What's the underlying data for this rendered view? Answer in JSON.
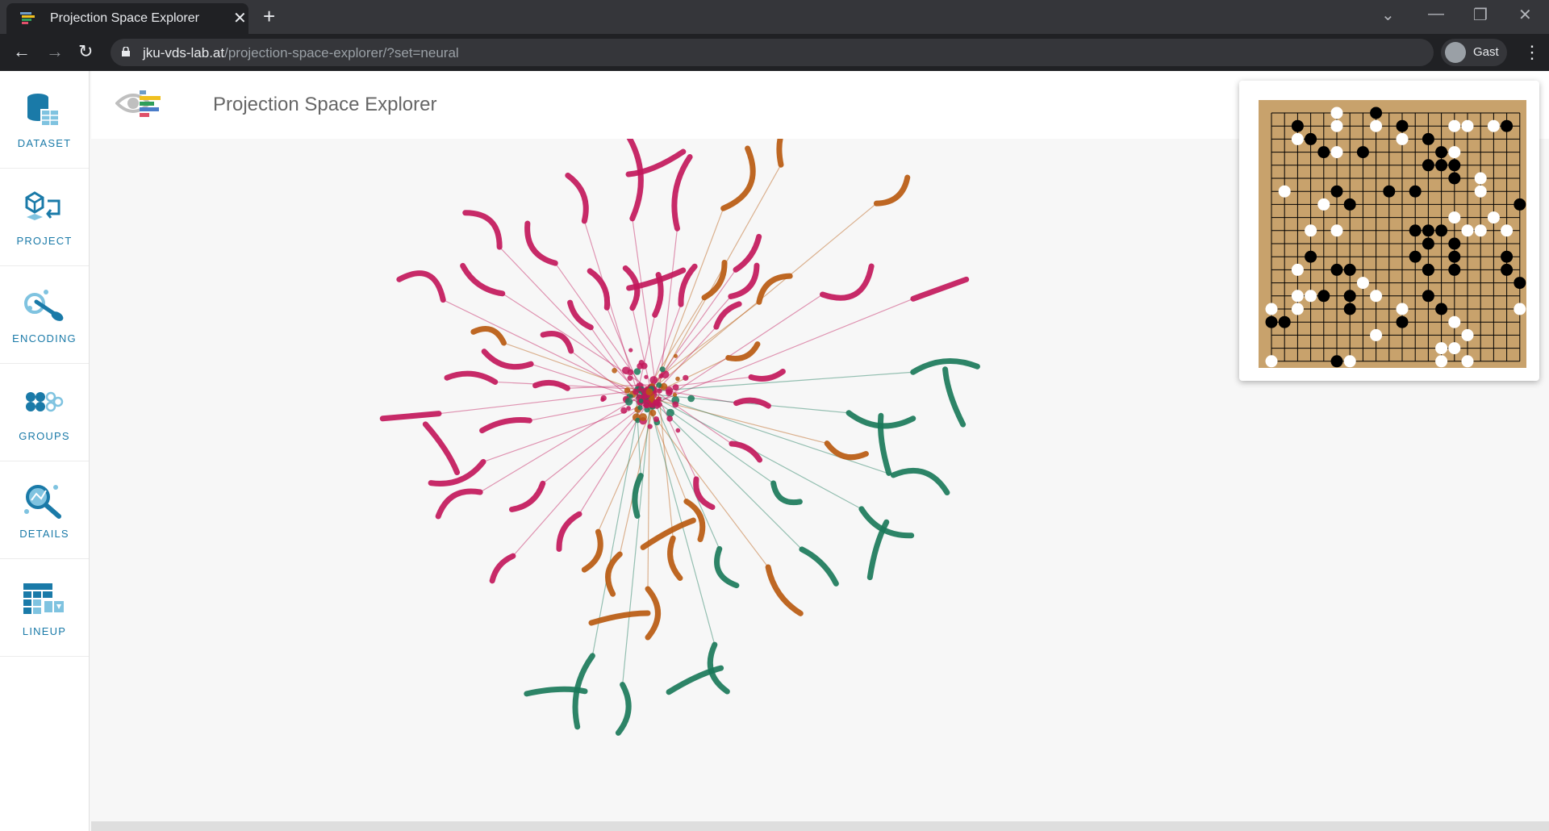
{
  "browser": {
    "tab_title": "Projection Space Explorer",
    "new_tab_symbol": "+",
    "close_symbol": "✕",
    "url_host": "jku-vds-lab.at",
    "url_path": "/projection-space-explorer/?set=neural",
    "profile_name": "Gast"
  },
  "sidebar": {
    "items": [
      {
        "label": "DATASET",
        "icon": "database-icon"
      },
      {
        "label": "PROJECT",
        "icon": "project-icon"
      },
      {
        "label": "ENCODING",
        "icon": "encoding-icon"
      },
      {
        "label": "GROUPS",
        "icon": "groups-icon"
      },
      {
        "label": "DETAILS",
        "icon": "details-icon"
      },
      {
        "label": "LINEUP",
        "icon": "lineup-icon"
      }
    ]
  },
  "header": {
    "title": "Projection Space Explorer"
  },
  "colors": {
    "pink": "#c2185b",
    "orange": "#b85a10",
    "green": "#1b7a5a",
    "board": "#c8a26c",
    "accent": "#1a7aa8"
  },
  "go_board": {
    "size": 19,
    "black": [
      [
        2,
        1
      ],
      [
        8,
        0
      ],
      [
        10,
        1
      ],
      [
        18,
        1
      ],
      [
        3,
        2
      ],
      [
        4,
        3
      ],
      [
        7,
        3
      ],
      [
        12,
        2
      ],
      [
        13,
        3
      ],
      [
        12,
        4
      ],
      [
        13,
        4
      ],
      [
        14,
        4
      ],
      [
        14,
        5
      ],
      [
        5,
        6
      ],
      [
        9,
        6
      ],
      [
        11,
        6
      ],
      [
        19,
        7
      ],
      [
        6,
        7
      ],
      [
        11,
        9
      ],
      [
        12,
        9
      ],
      [
        13,
        9
      ],
      [
        12,
        10
      ],
      [
        14,
        10
      ],
      [
        11,
        11
      ],
      [
        14,
        11
      ],
      [
        3,
        11
      ],
      [
        12,
        12
      ],
      [
        14,
        12
      ],
      [
        5,
        12
      ],
      [
        6,
        12
      ],
      [
        18,
        11
      ],
      [
        18,
        12
      ],
      [
        19,
        13
      ],
      [
        4,
        14
      ],
      [
        6,
        14
      ],
      [
        12,
        14
      ],
      [
        6,
        15
      ],
      [
        13,
        15
      ],
      [
        0,
        16
      ],
      [
        1,
        16
      ],
      [
        10,
        16
      ],
      [
        5,
        19
      ],
      [
        12,
        12
      ]
    ],
    "white": [
      [
        5,
        0
      ],
      [
        5,
        1
      ],
      [
        8,
        1
      ],
      [
        2,
        2
      ],
      [
        10,
        2
      ],
      [
        14,
        1
      ],
      [
        15,
        1
      ],
      [
        17,
        1
      ],
      [
        5,
        3
      ],
      [
        14,
        3
      ],
      [
        16,
        5
      ],
      [
        16,
        6
      ],
      [
        1,
        6
      ],
      [
        4,
        7
      ],
      [
        14,
        8
      ],
      [
        17,
        8
      ],
      [
        3,
        9
      ],
      [
        5,
        9
      ],
      [
        15,
        9
      ],
      [
        16,
        9
      ],
      [
        18,
        9
      ],
      [
        2,
        12
      ],
      [
        7,
        13
      ],
      [
        8,
        14
      ],
      [
        2,
        14
      ],
      [
        3,
        14
      ],
      [
        10,
        15
      ],
      [
        19,
        15
      ],
      [
        14,
        16
      ],
      [
        15,
        17
      ],
      [
        8,
        17
      ],
      [
        13,
        18
      ],
      [
        14,
        18
      ],
      [
        13,
        19
      ],
      [
        15,
        19
      ],
      [
        0,
        19
      ],
      [
        6,
        19
      ],
      [
        0,
        15
      ],
      [
        2,
        15
      ]
    ]
  }
}
